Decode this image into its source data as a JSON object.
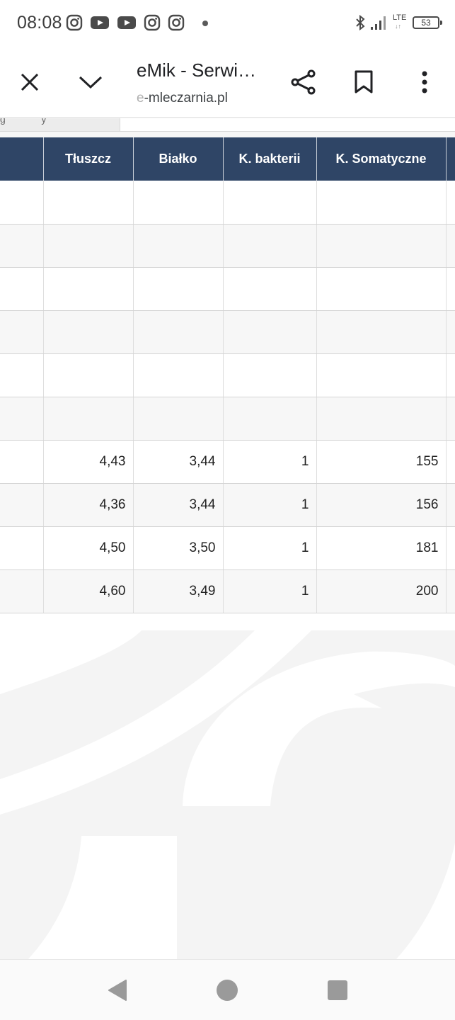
{
  "status_bar": {
    "time": "08:08",
    "network": "LTE",
    "battery": "53",
    "left_icons": [
      "instagram-icon",
      "youtube-icon",
      "youtube-icon",
      "instagram-icon",
      "instagram-icon"
    ]
  },
  "toolbar": {
    "title": "eMik - Serwi…",
    "url_fade": "e",
    "url_main": "-mleczarnia.pl"
  },
  "table": {
    "headers": [
      "",
      "Tłuszcz",
      "Białko",
      "K. bakterii",
      "K. Somatyczne",
      ""
    ],
    "rows": [
      [
        "",
        "",
        "",
        "",
        "",
        ""
      ],
      [
        "",
        "",
        "",
        "",
        "",
        ""
      ],
      [
        "",
        "",
        "",
        "",
        "",
        ""
      ],
      [
        "",
        "",
        "",
        "",
        "",
        ""
      ],
      [
        "",
        "",
        "",
        "",
        "",
        ""
      ],
      [
        "",
        "",
        "",
        "",
        "",
        ""
      ],
      [
        "",
        "4,43",
        "3,44",
        "1",
        "155",
        ""
      ],
      [
        "",
        "4,36",
        "3,44",
        "1",
        "156",
        ""
      ],
      [
        "",
        "4,50",
        "3,50",
        "1",
        "181",
        ""
      ],
      [
        "",
        "4,60",
        "3,49",
        "1",
        "200",
        ""
      ]
    ]
  },
  "colors": {
    "header_bg": "#2f4566",
    "header_text": "#ffffff"
  }
}
